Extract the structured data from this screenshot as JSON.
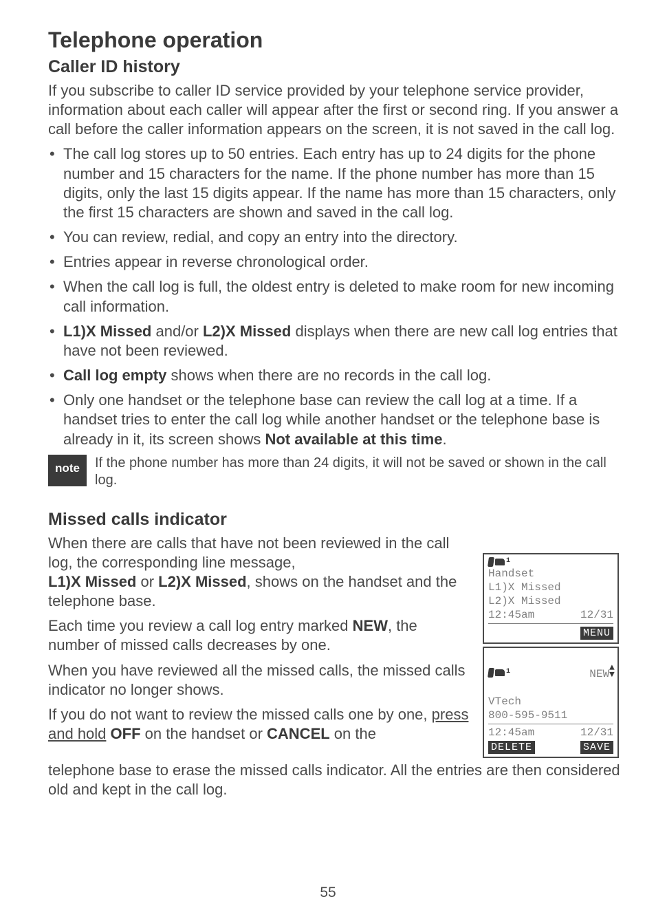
{
  "heading1": "Telephone operation",
  "heading2": "Caller ID history",
  "intro": "If you subscribe to caller ID service provided by your telephone service provider, information about each caller will appear after the first or second ring. If you answer a call before the caller information appears on the screen, it is not saved in the call log.",
  "bullets": {
    "b1": "The call log stores up to 50 entries. Each entry has up to 24 digits for the phone number and 15 characters for the name. If the phone number has more than 15 digits, only the last 15 digits appear. If the name has more than 15 characters, only the first 15 characters are shown and saved in the call log.",
    "b2": "You can review, redial, and copy an entry into the directory.",
    "b3": "Entries appear in reverse chronological order.",
    "b4": "When the call log is full, the oldest entry is deleted to make room for new incoming call information.",
    "b5a": "L1)X Missed",
    "b5b": " and/or ",
    "b5c": "L2)X Missed",
    "b5d": " displays when there are new call log entries that have not been reviewed.",
    "b6a": "Call log empty",
    "b6b": " shows when there are no records in the call log.",
    "b7a": "Only one handset or the telephone base can review the call log at a time. If a handset tries to enter the call log while another handset or the telephone base is already in it, its screen shows ",
    "b7b": "Not available at this time",
    "b7c": "."
  },
  "note_label": "note",
  "note_text": "If the phone number has more than 24 digits, it will not be saved or shown in the call log.",
  "heading3": "Missed calls indicator",
  "missed": {
    "p1a": "When there are calls that have not been reviewed in the call log, the corresponding line message, ",
    "p1b": "L1)X Missed",
    "p1c": " or ",
    "p1d": "L2)X Missed",
    "p1e": ", shows on the handset and the telephone base.",
    "p2a": "Each time you review a call log entry marked ",
    "p2b": "NEW",
    "p2c": ", the number of missed calls decreases by one.",
    "p3": "When you have reviewed all the missed calls, the missed calls indicator no longer shows.",
    "p4a": "If you do not want to review the missed calls one by one, ",
    "p4b": "press and hold",
    "p4c": " ",
    "p4d": "OFF",
    "p4e": " on the handset or ",
    "p4f": "CANCEL",
    "p4g": " on the"
  },
  "tail": "telephone base to erase the missed calls indicator. All the entries are then considered old and kept in the call log.",
  "lcd1": {
    "title": "Handset",
    "line1": "L1)X Missed",
    "line2": "L2)X Missed",
    "time": "12:45am",
    "date": "12/31",
    "soft_right": "MENU"
  },
  "lcd2": {
    "badge": "NEW",
    "title": "VTech",
    "number": "800-595-9511",
    "time": "12:45am",
    "date": "12/31",
    "soft_left": "DELETE",
    "soft_right": "SAVE"
  },
  "page": "55"
}
